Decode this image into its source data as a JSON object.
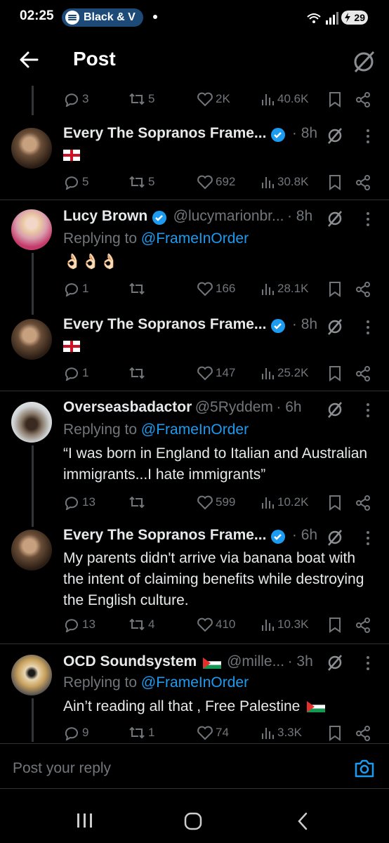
{
  "status_bar": {
    "time": "02:25",
    "now_playing": "Black & V",
    "battery": "29"
  },
  "header": {
    "title": "Post"
  },
  "top_stats": {
    "replies": "3",
    "reposts": "5",
    "likes": "2K",
    "views": "40.6K"
  },
  "posts": [
    {
      "name": "Every The Sopranos Frame...",
      "handle": "",
      "time": "· 8h",
      "replying_label": "",
      "replying_to": "",
      "text": "",
      "stats": {
        "replies": "5",
        "reposts": "5",
        "likes": "692",
        "views": "30.8K"
      }
    },
    {
      "name": "Lucy Brown",
      "handle": "@lucymarionbr...",
      "time": "· 8h",
      "replying_label": "Replying to",
      "replying_to": "@FrameInOrder",
      "text": "👌🏻👌🏻👌🏻",
      "stats": {
        "replies": "1",
        "reposts": "",
        "likes": "166",
        "views": "28.1K"
      }
    },
    {
      "name": "Every The Sopranos Frame...",
      "handle": "",
      "time": "· 8h",
      "replying_label": "",
      "replying_to": "",
      "text": "",
      "stats": {
        "replies": "1",
        "reposts": "",
        "likes": "147",
        "views": "25.2K"
      }
    },
    {
      "name": "Overseasbadactor",
      "handle": "@5Ryddem",
      "time": "· 6h",
      "replying_label": "Replying to",
      "replying_to": "@FrameInOrder",
      "text": "“I was born in England to Italian and Australian immigrants...I hate immigrants”",
      "stats": {
        "replies": "13",
        "reposts": "",
        "likes": "599",
        "views": "10.2K"
      }
    },
    {
      "name": "Every The Sopranos Frame...",
      "handle": "",
      "time": "· 6h",
      "replying_label": "",
      "replying_to": "",
      "text": "My parents didn't arrive via banana boat with the intent of claiming benefits while destroying the English culture.",
      "stats": {
        "replies": "13",
        "reposts": "4",
        "likes": "410",
        "views": "10.3K"
      }
    },
    {
      "name": "OCD Soundsystem",
      "handle": "@mille...",
      "time": "· 3h",
      "replying_label": "Replying to",
      "replying_to": "@FrameInOrder",
      "text": "Ain’t reading all that , Free Palestine",
      "stats": {
        "replies": "9",
        "reposts": "1",
        "likes": "74",
        "views": "3.3K"
      }
    }
  ],
  "composer": {
    "placeholder": "Post your reply"
  },
  "colors": {
    "background": "#000000",
    "accent": "#1d9bf0",
    "muted": "#71767b",
    "text": "#e7e9ea",
    "divider": "#2f3336"
  }
}
